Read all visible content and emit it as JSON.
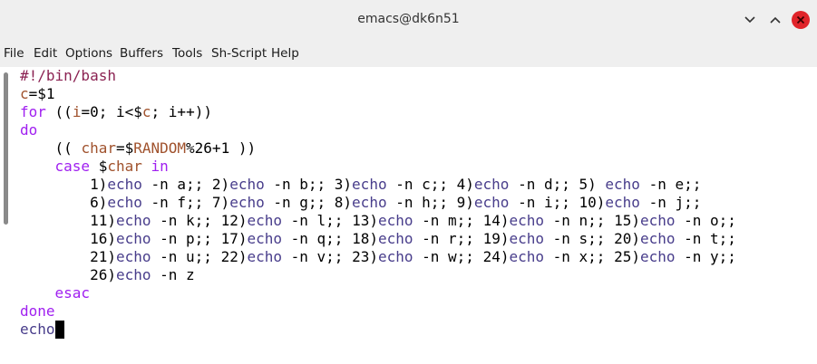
{
  "window": {
    "title": "emacs@dk6n51",
    "controls": {
      "minimize_icon": "chevron-down-icon",
      "maximize_icon": "chevron-up-icon",
      "close_icon": "close-icon",
      "close_color": "#e0242a"
    }
  },
  "menubar": {
    "items": [
      "File",
      "Edit",
      "Options",
      "Buffers",
      "Tools",
      "Sh-Script",
      "Help"
    ]
  },
  "editor": {
    "lines": [
      [
        {
          "t": "#!/bin/bash",
          "c": "str"
        }
      ],
      [
        {
          "t": "c",
          "c": "var"
        },
        {
          "t": "=$1",
          "c": ""
        }
      ],
      [
        {
          "t": "for",
          "c": "kw"
        },
        {
          "t": " ((",
          "c": ""
        },
        {
          "t": "i",
          "c": "var"
        },
        {
          "t": "=0; i<$",
          "c": ""
        },
        {
          "t": "c",
          "c": "var"
        },
        {
          "t": "; i++))",
          "c": ""
        }
      ],
      [
        {
          "t": "do",
          "c": "kw"
        }
      ],
      [
        {
          "t": "    (( ",
          "c": ""
        },
        {
          "t": "char",
          "c": "var"
        },
        {
          "t": "=$",
          "c": ""
        },
        {
          "t": "RANDOM",
          "c": "var"
        },
        {
          "t": "%26+1 ))",
          "c": ""
        }
      ],
      [
        {
          "t": "    ",
          "c": ""
        },
        {
          "t": "case",
          "c": "kw"
        },
        {
          "t": " $",
          "c": ""
        },
        {
          "t": "char",
          "c": "var"
        },
        {
          "t": " ",
          "c": ""
        },
        {
          "t": "in",
          "c": "kw"
        }
      ],
      [
        {
          "t": "        1)",
          "c": ""
        },
        {
          "t": "echo",
          "c": "bi"
        },
        {
          "t": " -n a;; 2)",
          "c": ""
        },
        {
          "t": "echo",
          "c": "bi"
        },
        {
          "t": " -n b;; 3)",
          "c": ""
        },
        {
          "t": "echo",
          "c": "bi"
        },
        {
          "t": " -n c;; 4)",
          "c": ""
        },
        {
          "t": "echo",
          "c": "bi"
        },
        {
          "t": " -n d;; 5) ",
          "c": ""
        },
        {
          "t": "echo",
          "c": "bi"
        },
        {
          "t": " -n e;;",
          "c": ""
        }
      ],
      [
        {
          "t": "        6)",
          "c": ""
        },
        {
          "t": "echo",
          "c": "bi"
        },
        {
          "t": " -n f;; 7)",
          "c": ""
        },
        {
          "t": "echo",
          "c": "bi"
        },
        {
          "t": " -n g;; 8)",
          "c": ""
        },
        {
          "t": "echo",
          "c": "bi"
        },
        {
          "t": " -n h;; 9)",
          "c": ""
        },
        {
          "t": "echo",
          "c": "bi"
        },
        {
          "t": " -n i;; 10)",
          "c": ""
        },
        {
          "t": "echo",
          "c": "bi"
        },
        {
          "t": " -n j;;",
          "c": ""
        }
      ],
      [
        {
          "t": "        11)",
          "c": ""
        },
        {
          "t": "echo",
          "c": "bi"
        },
        {
          "t": " -n k;; 12)",
          "c": ""
        },
        {
          "t": "echo",
          "c": "bi"
        },
        {
          "t": " -n l;; 13)",
          "c": ""
        },
        {
          "t": "echo",
          "c": "bi"
        },
        {
          "t": " -n m;; 14)",
          "c": ""
        },
        {
          "t": "echo",
          "c": "bi"
        },
        {
          "t": " -n n;; 15)",
          "c": ""
        },
        {
          "t": "echo",
          "c": "bi"
        },
        {
          "t": " -n o;;",
          "c": ""
        }
      ],
      [
        {
          "t": "        16)",
          "c": ""
        },
        {
          "t": "echo",
          "c": "bi"
        },
        {
          "t": " -n p;; 17)",
          "c": ""
        },
        {
          "t": "echo",
          "c": "bi"
        },
        {
          "t": " -n q;; 18)",
          "c": ""
        },
        {
          "t": "echo",
          "c": "bi"
        },
        {
          "t": " -n r;; 19)",
          "c": ""
        },
        {
          "t": "echo",
          "c": "bi"
        },
        {
          "t": " -n s;; 20)",
          "c": ""
        },
        {
          "t": "echo",
          "c": "bi"
        },
        {
          "t": " -n t;;",
          "c": ""
        }
      ],
      [
        {
          "t": "        21)",
          "c": ""
        },
        {
          "t": "echo",
          "c": "bi"
        },
        {
          "t": " -n u;; 22)",
          "c": ""
        },
        {
          "t": "echo",
          "c": "bi"
        },
        {
          "t": " -n v;; 23)",
          "c": ""
        },
        {
          "t": "echo",
          "c": "bi"
        },
        {
          "t": " -n w;; 24)",
          "c": ""
        },
        {
          "t": "echo",
          "c": "bi"
        },
        {
          "t": " -n x;; 25)",
          "c": ""
        },
        {
          "t": "echo",
          "c": "bi"
        },
        {
          "t": " -n y;;",
          "c": ""
        }
      ],
      [
        {
          "t": "        26)",
          "c": ""
        },
        {
          "t": "echo",
          "c": "bi"
        },
        {
          "t": " -n z",
          "c": ""
        }
      ],
      [
        {
          "t": "    ",
          "c": ""
        },
        {
          "t": "esac",
          "c": "kw"
        }
      ],
      [
        {
          "t": "done",
          "c": "kw"
        }
      ],
      [
        {
          "t": "echo",
          "c": "bi"
        }
      ]
    ],
    "colors": {
      "keyword": "#a020f0",
      "variable": "#a0522d",
      "builtin": "#483d8b",
      "string": "#8b2252"
    }
  }
}
